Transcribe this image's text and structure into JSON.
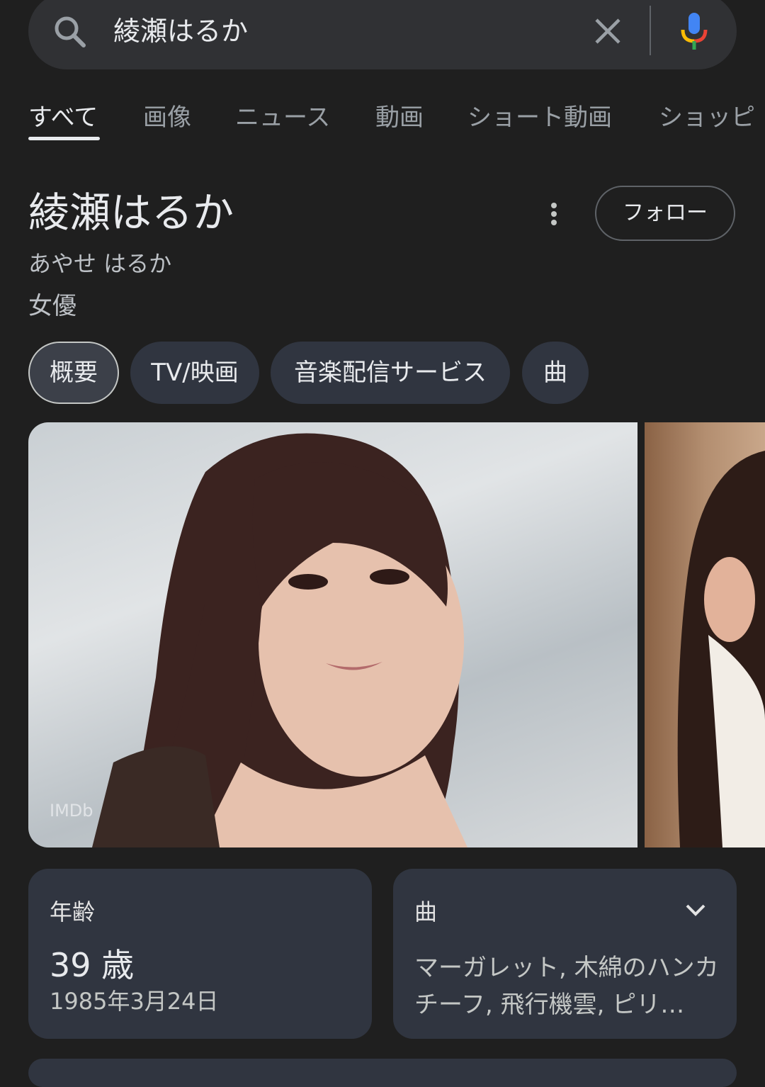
{
  "search": {
    "query": "綾瀬はるか"
  },
  "tabs": [
    "すべて",
    "画像",
    "ニュース",
    "動画",
    "ショート動画",
    "ショッピ"
  ],
  "knowledge_panel": {
    "title": "綾瀬はるか",
    "reading": "あやせ はるか",
    "subtitle": "女優",
    "follow_label": "フォロー",
    "chips": [
      "概要",
      "TV/映画",
      "音楽配信サービス",
      "曲"
    ],
    "photo_credit": "IMDb"
  },
  "age_card": {
    "label": "年齢",
    "value": "39 歳",
    "birthdate": "1985年3月24日"
  },
  "songs_card": {
    "label": "曲",
    "text": "マーガレット, 木綿のハンカチーフ, 飛行機雲, ピリ…"
  },
  "colors": {
    "background": "#1f1f1f",
    "surface": "#303540",
    "accent_blue": "#4285f4"
  }
}
